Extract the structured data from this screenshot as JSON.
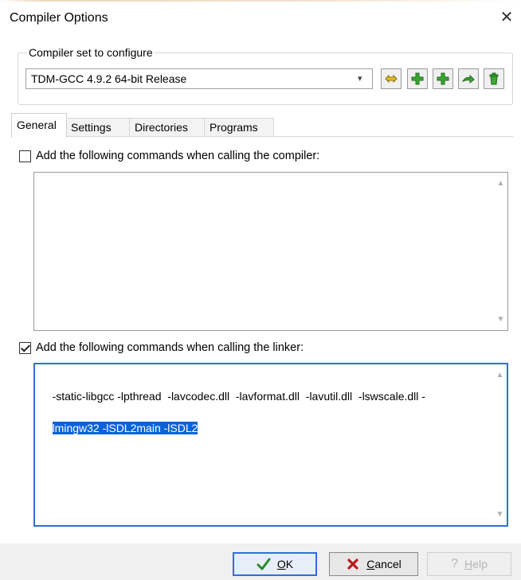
{
  "window": {
    "title": "Compiler Options"
  },
  "compiler_set": {
    "legend": "Compiler set to configure",
    "selected": "TDM-GCC 4.9.2 64-bit Release"
  },
  "tabs": [
    {
      "label": "General",
      "active": true
    },
    {
      "label": "Settings",
      "active": false
    },
    {
      "label": "Directories",
      "active": false
    },
    {
      "label": "Programs",
      "active": false
    }
  ],
  "general": {
    "compiler_commands": {
      "label": "Add the following commands when calling the compiler:",
      "checked": false,
      "value": ""
    },
    "linker_commands": {
      "label": "Add the following commands when calling the linker:",
      "checked": true,
      "value_unselected": "-static-libgcc -lpthread  -lavcodec.dll  -lavformat.dll  -lavutil.dll  -lswscale.dll -",
      "value_selected": "lmingw32 -lSDL2main -lSDL2"
    }
  },
  "buttons": {
    "ok": {
      "label": "OK",
      "mnemonic": "O",
      "rest": "K"
    },
    "cancel": {
      "label": "Cancel",
      "mnemonic": "C",
      "rest": "ancel"
    },
    "help": {
      "label": "Help",
      "mnemonic": "H",
      "rest": "elp"
    }
  },
  "colors": {
    "selection": "#0a64d8",
    "focus_border": "#2f6fd6",
    "ok_check": "#2a8a2a",
    "cancel_x": "#c0181a",
    "tool_green": "#3aa832",
    "tool_yellow": "#e2c02a"
  }
}
